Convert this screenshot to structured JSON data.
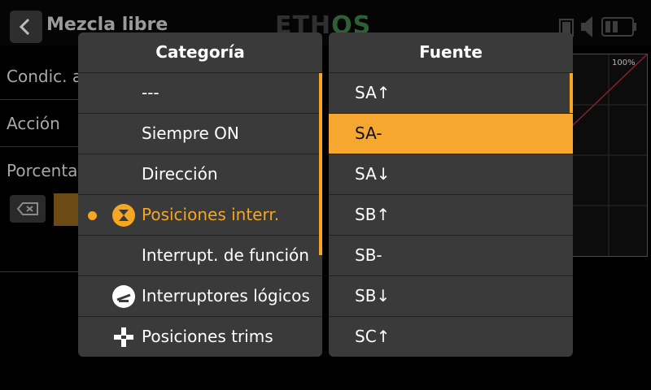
{
  "header": {
    "title": "Mezcla libre",
    "logo_a": "ETH",
    "logo_b": "OS",
    "icons": [
      "back-icon",
      "sd-card-icon",
      "volume-icon",
      "battery-icon"
    ]
  },
  "background": {
    "labels": [
      "Condic. a",
      "Acción",
      "Porcenta"
    ],
    "graph_label": "100%"
  },
  "category_panel": {
    "title": "Categoría",
    "items": [
      {
        "label": "---",
        "icon": ""
      },
      {
        "label": "Siempre ON",
        "icon": ""
      },
      {
        "label": "Dirección",
        "icon": ""
      },
      {
        "label": "Posiciones interr.",
        "icon": "switch-position-icon",
        "selected": true
      },
      {
        "label": "Interrupt. de función",
        "icon": ""
      },
      {
        "label": "Interruptores lógicos",
        "icon": "logic-switch-icon"
      },
      {
        "label": "Posiciones trims",
        "icon": "trim-icon"
      }
    ]
  },
  "source_panel": {
    "title": "Fuente",
    "items": [
      {
        "label": "SA↑"
      },
      {
        "label": "SA-",
        "selected": true
      },
      {
        "label": "SA↓"
      },
      {
        "label": "SB↑"
      },
      {
        "label": "SB-"
      },
      {
        "label": "SB↓"
      },
      {
        "label": "SC↑"
      }
    ]
  },
  "colors": {
    "accent": "#f5a623",
    "panel": "#3a3a3a",
    "background": "#000000"
  }
}
